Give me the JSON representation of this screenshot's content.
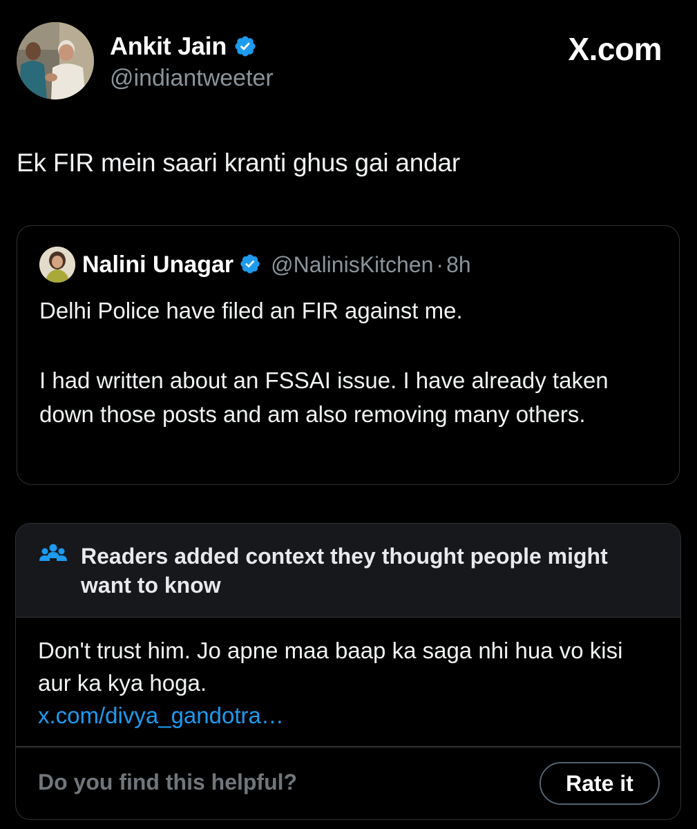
{
  "colors": {
    "background": "#000000",
    "verified_badge": "#1d9bf0",
    "link": "#1d9bf0",
    "secondary_text": "#8b949b",
    "card_border": "#2f3336",
    "note_header_bg": "#16181c"
  },
  "site": {
    "logo": "X.com"
  },
  "author": {
    "name": "Ankit Jain",
    "handle": "@indiantweeter",
    "verified": true,
    "avatar_icon": "profile-photo"
  },
  "tweet": {
    "text": "Ek FIR mein saari kranti ghus gai andar"
  },
  "quoted": {
    "name": "Nalini Unagar",
    "handle": "@NalinisKitchen",
    "separator": "·",
    "time": "8h",
    "verified": true,
    "paragraphs": [
      "Delhi Police have filed an FIR against me.",
      "I had written about an FSSAI issue. I have already taken down those posts and am also removing many others."
    ]
  },
  "note": {
    "icon": "people-group-icon",
    "title": "Readers added context they thought people might want to know",
    "body": "Don't trust him. Jo apne maa baap ka saga nhi hua vo kisi aur ka kya hoga.",
    "link": "x.com/divya_gandotra…",
    "question": "Do you find this helpful?",
    "rate_label": "Rate it"
  }
}
